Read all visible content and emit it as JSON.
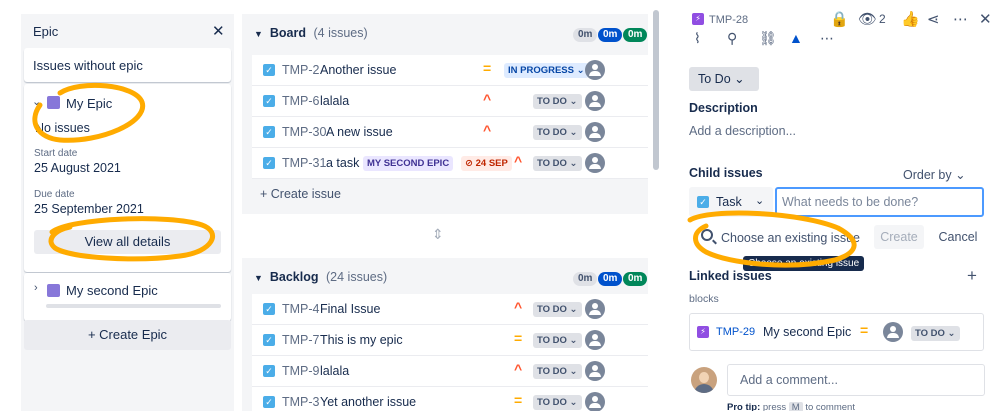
{
  "epic_panel": {
    "title": "Epic",
    "issues_without_epic": "Issues without epic",
    "my_epic": {
      "name": "My Epic",
      "no_issues": "No issues",
      "start_label": "Start date",
      "start_value": "25 August 2021",
      "due_label": "Due date",
      "due_value": "25 September 2021",
      "view_all": "View all details"
    },
    "second_epic": {
      "name": "My second Epic"
    },
    "create_epic": "+ Create Epic"
  },
  "board": {
    "title": "Board",
    "count": "(4 issues)",
    "pills": [
      "0m",
      "0m",
      "0m"
    ],
    "rows": [
      {
        "key": "TMP-2",
        "summary": "Another issue",
        "status": "IN PROGRESS",
        "priority": "medium"
      },
      {
        "key": "TMP-6",
        "summary": "lalala",
        "status": "TO DO",
        "priority": "high"
      },
      {
        "key": "TMP-30",
        "summary": "A new issue",
        "status": "TO DO",
        "priority": "high"
      },
      {
        "key": "TMP-31",
        "summary": "a task",
        "epic": "MY SECOND EPIC",
        "due": "24 SEP",
        "status": "TO DO",
        "priority": "high"
      }
    ],
    "create_issue": "+ Create issue"
  },
  "backlog": {
    "title": "Backlog",
    "count": "(24 issues)",
    "pills": [
      "0m",
      "0m",
      "0m"
    ],
    "rows": [
      {
        "key": "TMP-4",
        "summary": "Final Issue",
        "status": "TO DO",
        "priority": "high"
      },
      {
        "key": "TMP-7",
        "summary": "This is my epic",
        "status": "TO DO",
        "priority": "medium"
      },
      {
        "key": "TMP-9",
        "summary": "lalala",
        "status": "TO DO",
        "priority": "high"
      },
      {
        "key": "TMP-3",
        "summary": "Yet another issue",
        "status": "TO DO",
        "priority": "medium"
      }
    ]
  },
  "detail": {
    "key": "TMP-28",
    "watch_count": "2",
    "status_button": "To Do",
    "description_label": "Description",
    "description_placeholder": "Add a description...",
    "child_issues_label": "Child issues",
    "order_by": "Order by",
    "child_type": "Task",
    "child_placeholder": "What needs to be done?",
    "choose_existing": "Choose an existing issue",
    "create": "Create",
    "cancel": "Cancel",
    "tooltip": "Choose an existing issue",
    "linked_label": "Linked issues",
    "blocks": "blocks",
    "linked": {
      "key": "TMP-29",
      "summary": "My second Epic",
      "status": "TO DO"
    },
    "comment_placeholder": "Add a comment...",
    "protip_label": "Pro tip:",
    "protip_text": "press",
    "protip_key": "M",
    "protip_tail": "to comment"
  },
  "colors": {
    "accent": "#0052cc",
    "annotation": "#ffab00",
    "epic": "#8777d9"
  }
}
